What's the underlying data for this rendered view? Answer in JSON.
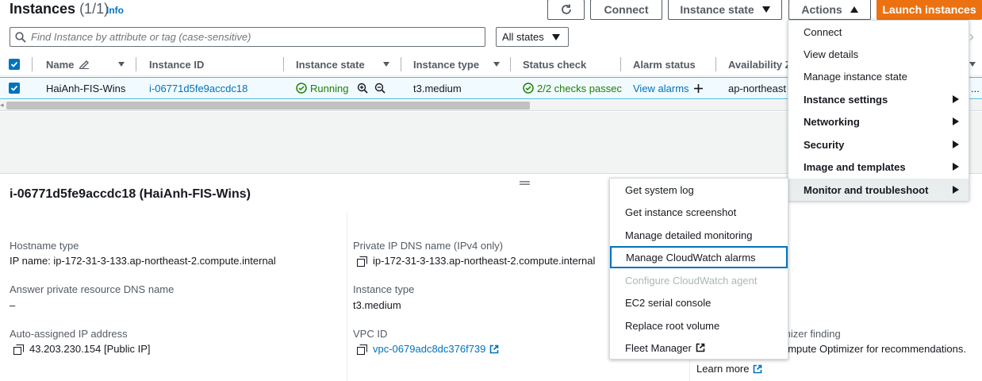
{
  "header": {
    "title": "Instances",
    "count": "(1/1)",
    "info": "Info",
    "connect": "Connect",
    "instance_state": "Instance state",
    "actions": "Actions",
    "launch": "Launch instances"
  },
  "search": {
    "placeholder": "Find Instance by attribute or tag (case-sensitive)",
    "states_filter": "All states"
  },
  "table": {
    "columns": [
      "Name",
      "Instance ID",
      "Instance state",
      "Instance type",
      "Status check",
      "Alarm status",
      "Availability Z"
    ],
    "row": {
      "name": "HaiAnh-FIS-Wins",
      "instance_id": "i-06771d5fe9accdc18",
      "state": "Running",
      "type": "t3.medium",
      "status_check": "2/2 checks passec",
      "alarm": "View alarms",
      "az": "ap-northeast"
    },
    "truncation": "..."
  },
  "details": {
    "title": "i-06771d5fe9accdc18 (HaiAnh-FIS-Wins)",
    "hostname_type_label": "Hostname type",
    "hostname_type_value": "IP name: ip-172-31-3-133.ap-northeast-2.compute.internal",
    "answer_dns_label": "Answer private resource DNS name",
    "answer_dns_value": "–",
    "auto_ip_label": "Auto-assigned IP address",
    "auto_ip_value": "43.203.230.154 [Public IP]",
    "private_dns_label": "Private IP DNS name (IPv4 only)",
    "private_dns_value": "ip-172-31-3-133.ap-northeast-2.compute.internal",
    "instance_type_label": "Instance type",
    "instance_type_value": "t3.medium",
    "vpc_label": "VPC ID",
    "vpc_value": "vpc-0679adc8dc376f739",
    "optimizer_label": "mizer finding",
    "optimizer_value": "ompute Optimizer for recommendations.",
    "learn_more": "Learn more"
  },
  "actions_menu": {
    "items": [
      "Connect",
      "View details",
      "Manage instance state",
      "Instance settings",
      "Networking",
      "Security",
      "Image and templates",
      "Monitor and troubleshoot"
    ]
  },
  "monitor_menu": {
    "items": [
      "Get system log",
      "Get instance screenshot",
      "Manage detailed monitoring",
      "Manage CloudWatch alarms",
      "Configure CloudWatch agent",
      "EC2 serial console",
      "Replace root volume",
      "Fleet Manager"
    ]
  },
  "colors": {
    "accent": "#0073bb",
    "primary_button": "#ec7211",
    "success": "#1d8102"
  }
}
